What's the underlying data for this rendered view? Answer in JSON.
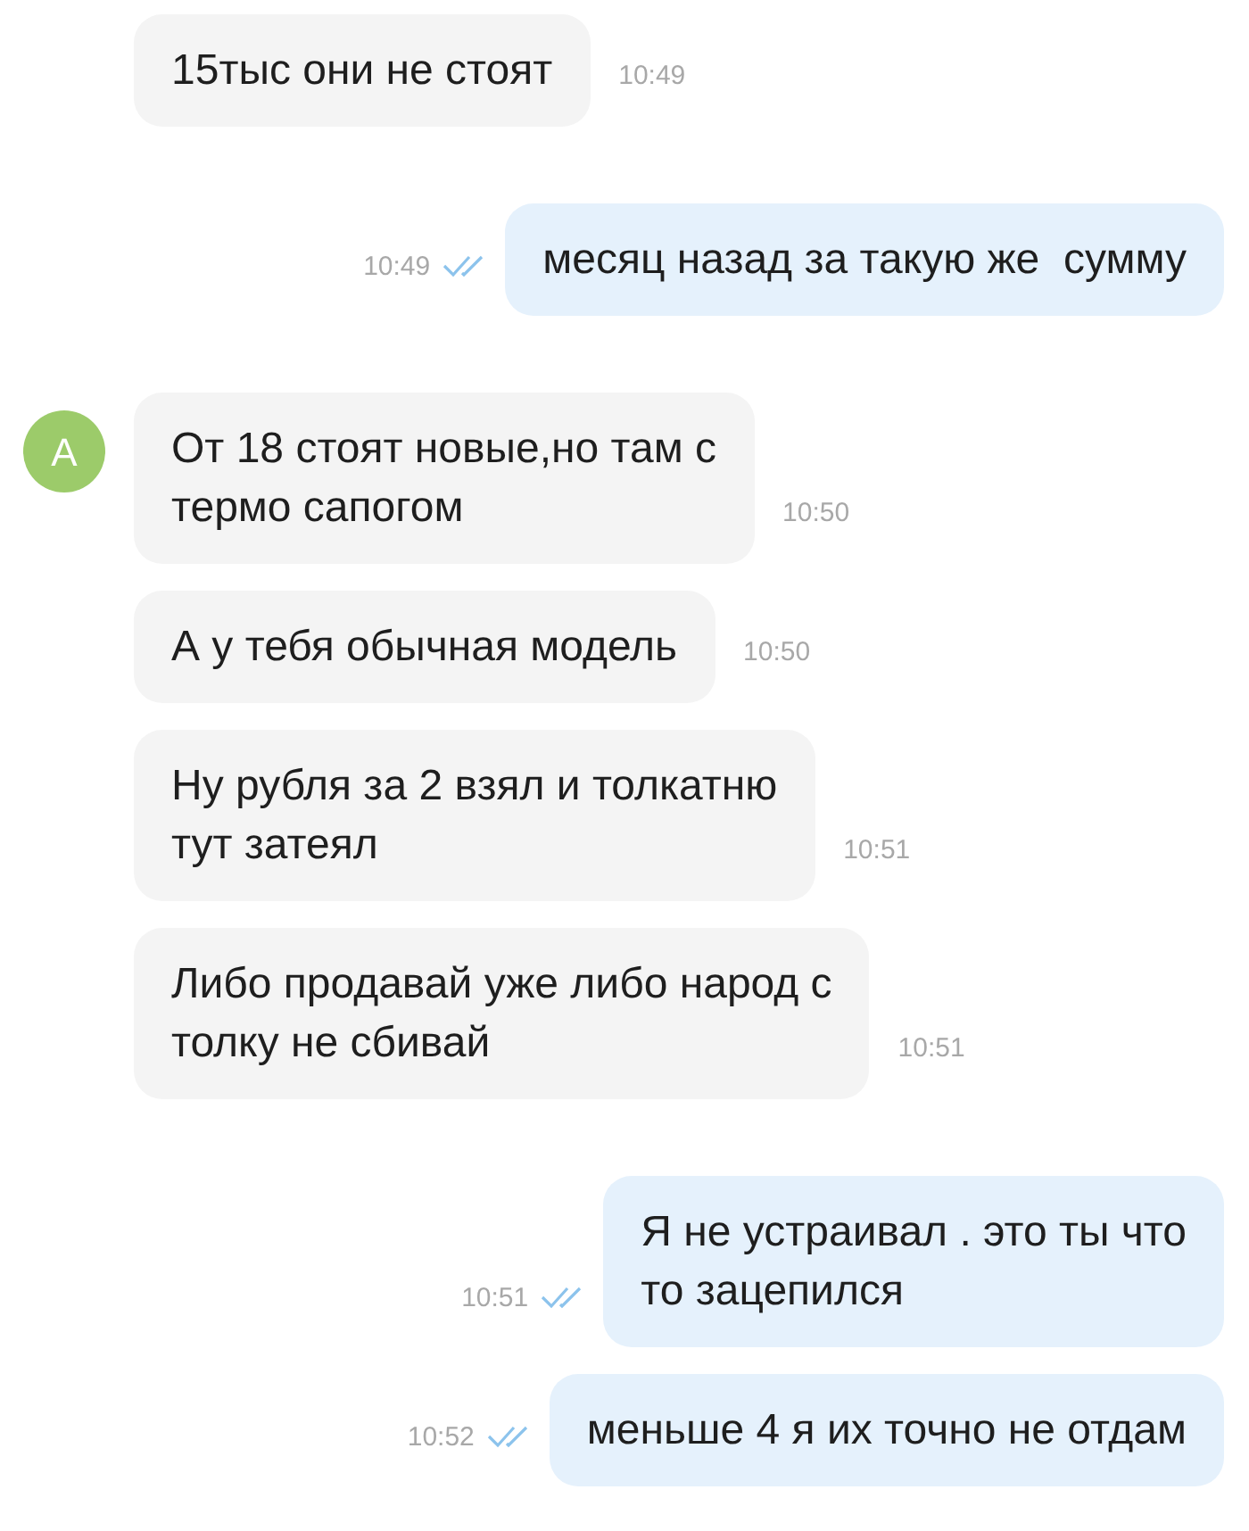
{
  "messages": [
    {
      "kind": "incoming",
      "text": "15тыс они не стоят",
      "time": "10:49"
    },
    {
      "kind": "outgoing",
      "text": "месяц назад за такую же  сумму",
      "time": "10:49",
      "read": true
    },
    {
      "kind": "incoming",
      "avatar": "А",
      "text": "От 18 стоят новые,но там с\nтермо сапогом",
      "time": "10:50"
    },
    {
      "kind": "incoming",
      "text": "А у тебя обычная модель",
      "time": "10:50"
    },
    {
      "kind": "incoming",
      "text": "Ну рубля за 2 взял и толкатню\nтут затеял",
      "time": "10:51"
    },
    {
      "kind": "incoming",
      "text": "Либо продавай уже либо народ с\nтолку не сбивай",
      "time": "10:51"
    },
    {
      "kind": "outgoing",
      "text": "Я не устраивал . это ты что\nто зацепился",
      "time": "10:51",
      "read": true
    },
    {
      "kind": "outgoing",
      "text": "меньше 4 я их точно не отдам",
      "time": "10:52",
      "read": true
    }
  ]
}
